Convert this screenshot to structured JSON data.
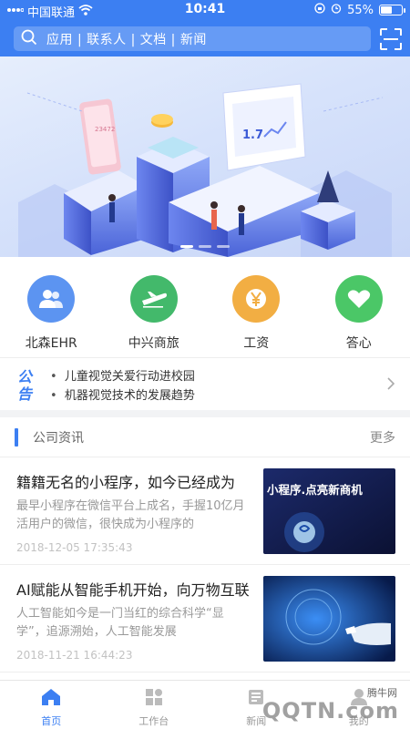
{
  "status": {
    "carrier": "中国联通",
    "time": "10:41",
    "battery": "55%",
    "battery_level": 0.55
  },
  "search": {
    "placeholder": "应用 | 联系人 | 文档 | 新闻"
  },
  "banner": {
    "active_slide": 1,
    "slides": 3,
    "screen_value": "1.7",
    "phone_value": "23472"
  },
  "apps": [
    {
      "label": "北森EHR",
      "icon": "users-icon",
      "color": "#5c94f1"
    },
    {
      "label": "中兴商旅",
      "icon": "airplane-icon",
      "color": "#43b96b"
    },
    {
      "label": "工资",
      "icon": "yen-icon",
      "color": "#f2ae43"
    },
    {
      "label": "答心",
      "icon": "heart-icon",
      "color": "#4bc767"
    }
  ],
  "notice": {
    "badge": "公告",
    "items": [
      "儿童视觉关爱行动进校园",
      "机器视觉技术的发展趋势"
    ]
  },
  "news": {
    "title": "公司资讯",
    "more": "更多",
    "items": [
      {
        "title": "籍籍无名的小程序，如今已经成为",
        "desc": "最早小程序在微信平台上成名，手握10亿月活用户的微信，很快成为小程序的",
        "date": "2018-12-05 17:35:43",
        "thumb_text": "小程序.点亮新商机"
      },
      {
        "title": "AI赋能从智能手机开始，向万物互联",
        "desc": "人工智能如今是一门当红的综合科学“显学”，追源溯始，人工智能发展",
        "date": "2018-11-21 16:44:23"
      }
    ]
  },
  "tabbar": [
    {
      "label": "首页",
      "active": true
    },
    {
      "label": "工作台",
      "active": false
    },
    {
      "label": "新闻",
      "active": false
    },
    {
      "label": "我的",
      "active": false
    }
  ],
  "watermark": {
    "top": "腾牛网",
    "main": "QQTN.com"
  },
  "colors": {
    "primary": "#3c7ff2",
    "background": "#f2f3f5"
  }
}
